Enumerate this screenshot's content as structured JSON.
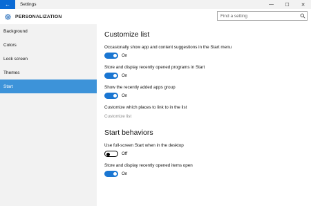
{
  "titlebar": {
    "title": "Settings",
    "back_glyph": "←",
    "controls": [
      "—",
      "☐",
      "✕"
    ]
  },
  "header": {
    "section_title": "PERSONALIZATION",
    "search_placeholder": "Find a setting"
  },
  "sidebar": {
    "items": [
      {
        "label": "Background",
        "active": false
      },
      {
        "label": "Colors",
        "active": false
      },
      {
        "label": "Lock screen",
        "active": false
      },
      {
        "label": "Themes",
        "active": false
      },
      {
        "label": "Start",
        "active": true
      }
    ]
  },
  "main": {
    "customize_heading": "Customize list",
    "settings": [
      {
        "label": "Occasionally show app and content suggestions in the Start menu",
        "state": "On"
      },
      {
        "label": "Store and display recently opened programs in Start",
        "state": "On"
      },
      {
        "label": "Show the recently added apps group",
        "state": "On"
      }
    ],
    "customize_places_label": "Customize which places to link to in the list",
    "customize_link": "Customize list",
    "behaviors_heading": "Start behaviors",
    "behaviors": [
      {
        "label": "Use full-screen Start when in the desktop",
        "state": "Off"
      },
      {
        "label": "Store and display recently opened items open",
        "state": "On"
      }
    ]
  },
  "colors": {
    "accent": "#1a76d2",
    "active_nav": "#3d93d9",
    "back_button": "#0a6ad5"
  },
  "icons": {
    "back": "back-arrow-icon",
    "header": "gear-icon",
    "search": "search-icon"
  }
}
